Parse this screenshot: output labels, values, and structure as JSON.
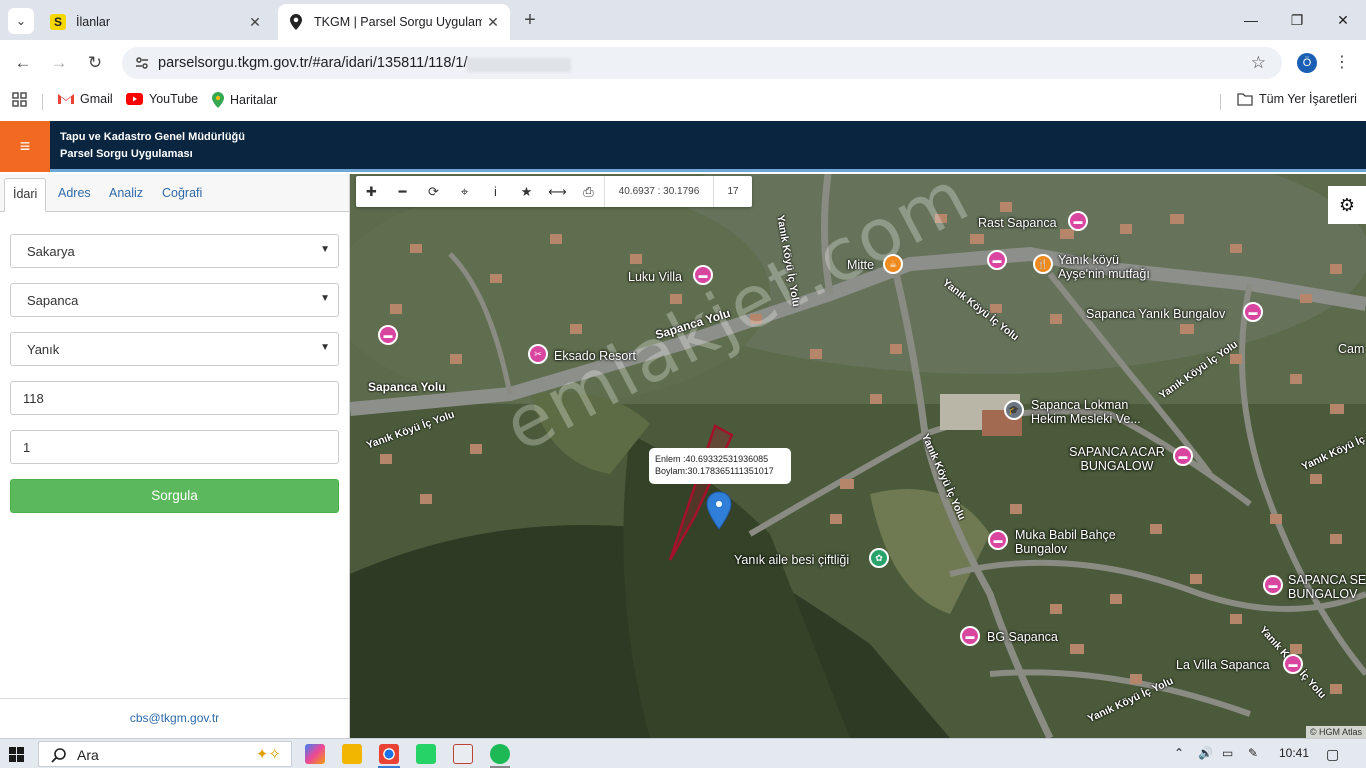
{
  "browser": {
    "tabs": [
      {
        "title": "İlanlar"
      },
      {
        "title": "TKGM | Parsel Sorgu Uygulaması"
      }
    ],
    "url": "parselsorgu.tkgm.gov.tr/#ara/idari/135811/118/1/",
    "profile_initial": "Ö",
    "bookmarks": [
      {
        "label": "Gmail"
      },
      {
        "label": "YouTube"
      },
      {
        "label": "Haritalar"
      }
    ],
    "all_bookmarks": "Tüm Yer İşaretleri"
  },
  "app": {
    "title_line1": "Tapu ve Kadastro Genel Müdürlüğü",
    "title_line2": "Parsel Sorgu Uygulaması"
  },
  "left_panel": {
    "tabs": [
      {
        "label": "İdari",
        "active": true
      },
      {
        "label": "Adres",
        "active": false
      },
      {
        "label": "Analiz",
        "active": false
      },
      {
        "label": "Coğrafi",
        "active": false
      }
    ],
    "il": "Sakarya",
    "ilce": "Sapanca",
    "mahalle": "Yanık",
    "ada": "118",
    "parsel": "1",
    "submit_label": "Sorgula",
    "footer_email": "cbs@tkgm.gov.tr"
  },
  "map": {
    "toolbar": {
      "coordinates": "40.6937 : 30.1796",
      "zoom": "17"
    },
    "popup": {
      "lat": "Enlem :40.69332531936085",
      "lon": "Boylam:30.178365111351017"
    },
    "watermark": "emlakjet.com",
    "attribution": "© HGM Atlas",
    "places": [
      {
        "name": "Rast Sapanca"
      },
      {
        "name": "Mitte"
      },
      {
        "name": "Yanık köyü Ayşe'nin mutfağı"
      },
      {
        "name": "Luku Villa"
      },
      {
        "name": "Sapanca Yanık Bungalov"
      },
      {
        "name": "Eksado Resort"
      },
      {
        "name": "Sapanca Lokman Hekim Mesleki Ve..."
      },
      {
        "name": "SAPANCA ACAR BUNGALOW"
      },
      {
        "name": "Yanık aile besi çiftliği"
      },
      {
        "name": "Muka Babil Bahçe Bungalov"
      },
      {
        "name": "SAPANCA SE BUNGALOV"
      },
      {
        "name": "BG Sapanca"
      },
      {
        "name": "La Villa Sapanca"
      },
      {
        "name": "Cam"
      }
    ],
    "roads": [
      {
        "name": "Sapanca Yolu"
      },
      {
        "name": "Sapanca Yolu"
      },
      {
        "name": "Yanık Köyü İç Yolu"
      },
      {
        "name": "Yanık Köyü İç Yolu"
      },
      {
        "name": "Yanık Köyü İç Yolu"
      },
      {
        "name": "Yanık Köyü İç Yolu"
      },
      {
        "name": "Yanık Köyü İç Yolu"
      },
      {
        "name": "Yanık Köyü İç Yolu"
      },
      {
        "name": "Yanık Köyü İç Yolu"
      },
      {
        "name": "Yanık Köyü İç Yolu"
      }
    ]
  },
  "taskbar": {
    "search_placeholder": "Ara",
    "time": "10:41"
  }
}
